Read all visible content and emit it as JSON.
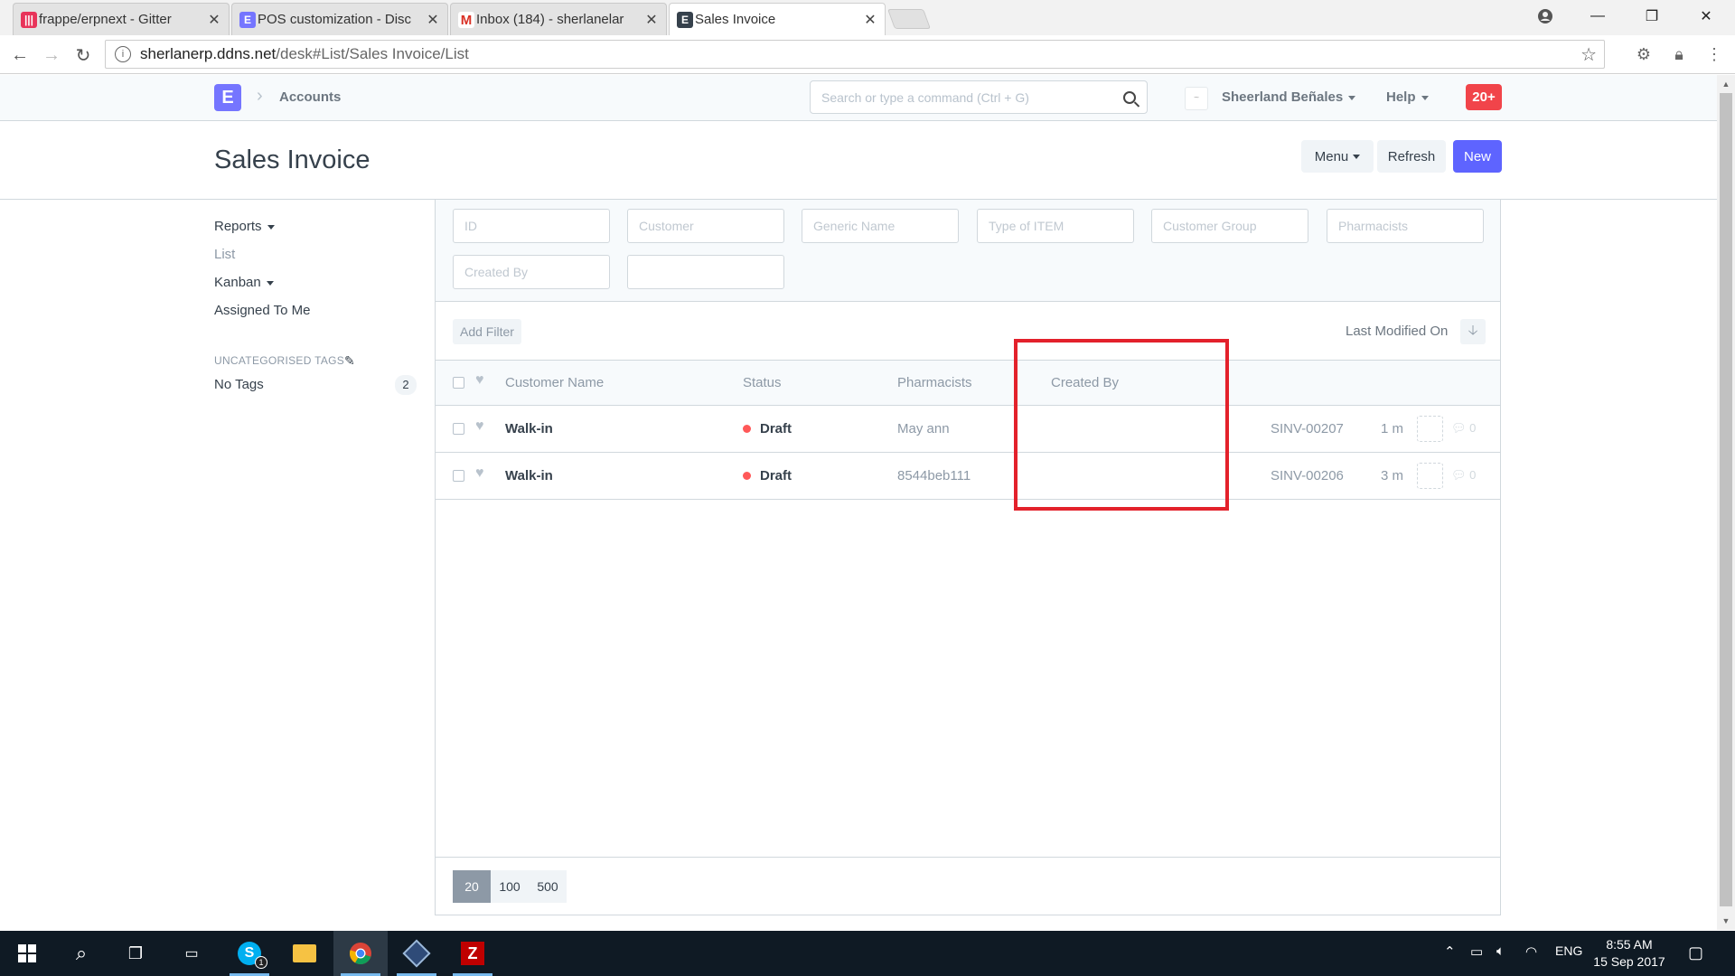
{
  "browser": {
    "tabs": [
      {
        "title": "frappe/erpnext - Gitter",
        "favicon": "gitter-icon"
      },
      {
        "title": "POS customization - Disc",
        "favicon": "erpnext-icon"
      },
      {
        "title": "Inbox (184) - sherlanelar",
        "favicon": "gmail-icon"
      },
      {
        "title": "Sales Invoice",
        "favicon": "erpnext-icon"
      }
    ],
    "url_host": "sherlanerp.ddns.net",
    "url_path": "/desk#List/Sales Invoice/List"
  },
  "navbar": {
    "logo_letter": "E",
    "breadcrumb": "Accounts",
    "search_placeholder": "Search or type a command (Ctrl + G)",
    "user": "Sheerland Beñales",
    "help": "Help",
    "notifications": "20+"
  },
  "page": {
    "title": "Sales Invoice",
    "menu_label": "Menu",
    "refresh_label": "Refresh",
    "new_label": "New"
  },
  "sidebar": {
    "items": [
      "Reports",
      "List",
      "Kanban",
      "Assigned To Me"
    ],
    "tags_heading": "UNCATEGORISED TAGS",
    "no_tags_label": "No Tags",
    "no_tags_count": "2"
  },
  "filters": {
    "placeholders": [
      "ID",
      "Customer",
      "Generic Name",
      "Type of ITEM",
      "Customer Group",
      "Pharmacists",
      "Created By",
      ""
    ]
  },
  "list": {
    "add_filter": "Add Filter",
    "sort_label": "Last Modified On",
    "columns": [
      "Customer Name",
      "Status",
      "Pharmacists",
      "Created By"
    ],
    "rows": [
      {
        "customer": "Walk-in",
        "status": "Draft",
        "pharmacist": "May ann",
        "created_by": "",
        "name": "SINV-00207",
        "modified": "1 m",
        "comments": "0"
      },
      {
        "customer": "Walk-in",
        "status": "Draft",
        "pharmacist": "8544beb111",
        "created_by": "",
        "name": "SINV-00206",
        "modified": "3 m",
        "comments": "0"
      }
    ],
    "page_sizes": [
      "20",
      "100",
      "500"
    ]
  },
  "taskbar": {
    "language": "ENG",
    "time": "8:55 AM",
    "date": "15 Sep 2017",
    "skype_badge": "1"
  },
  "colors": {
    "primary": "#5e64ff",
    "draft_dot": "#ff5858",
    "highlight": "#e3212b",
    "notification": "#f1444a"
  }
}
